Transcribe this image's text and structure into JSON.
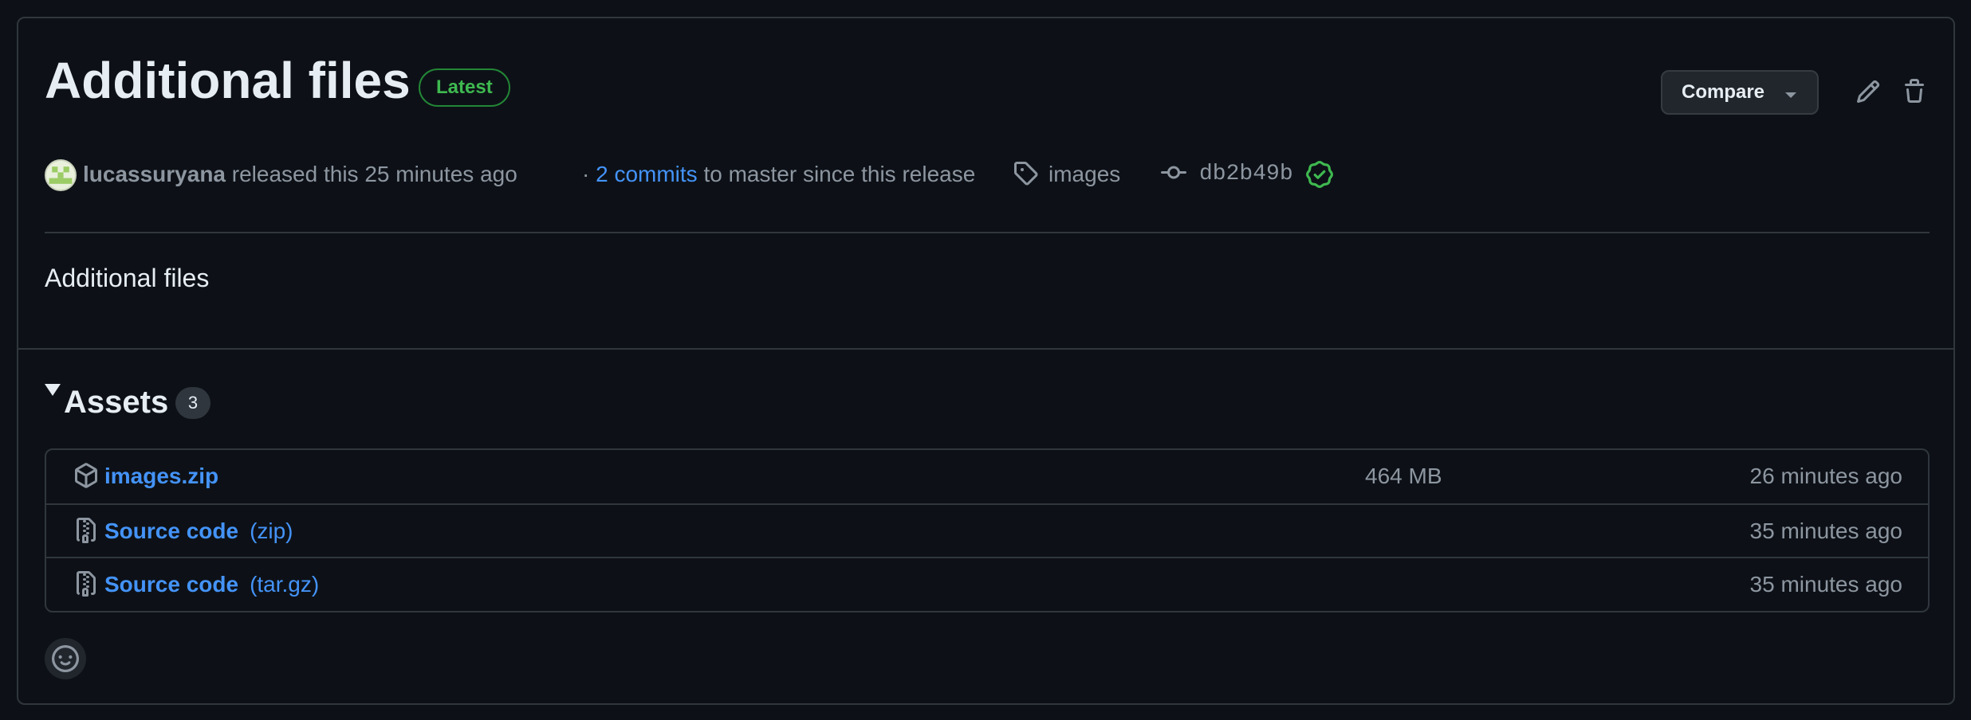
{
  "release": {
    "title": "Additional files",
    "latest_label": "Latest",
    "compare_label": "Compare",
    "author": "lucassuryana",
    "released_text": "released this 25 minutes ago",
    "commits_prefix": "·",
    "commits_link": "2 commits",
    "commits_suffix": "to master since this release",
    "tag": "images",
    "commit_sha": "db2b49b",
    "description": "Additional files"
  },
  "assets": {
    "title": "Assets",
    "count": "3",
    "items": [
      {
        "name": "images.zip",
        "ext": "",
        "size": "464 MB",
        "time": "26 minutes ago",
        "icon": "package-icon"
      },
      {
        "name": "Source code",
        "ext": "(zip)",
        "size": "",
        "time": "35 minutes ago",
        "icon": "file-zip-icon"
      },
      {
        "name": "Source code",
        "ext": "(tar.gz)",
        "size": "",
        "time": "35 minutes ago",
        "icon": "file-zip-icon"
      }
    ]
  },
  "colors": {
    "background": "#0d1117",
    "border": "#30363d",
    "link": "#4493f8",
    "success": "#3fb950",
    "muted": "#8d96a0"
  }
}
